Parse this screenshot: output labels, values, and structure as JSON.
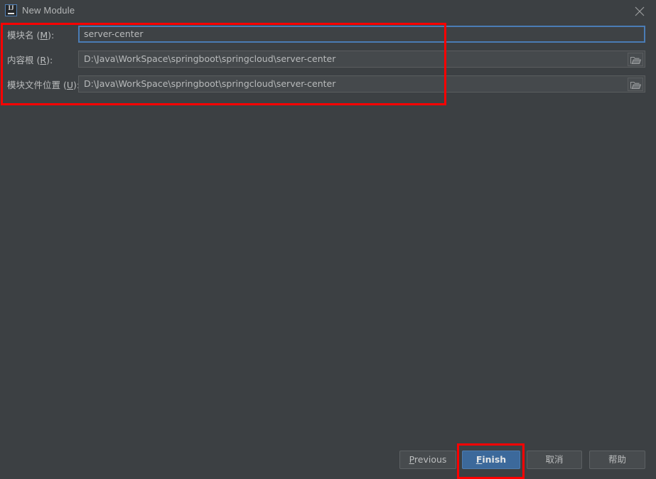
{
  "window": {
    "title": "New Module",
    "icon": "intellij-idea-icon",
    "icon_text": "IJ",
    "close_icon": "close-icon"
  },
  "form": {
    "rows": [
      {
        "label_text": "模块名 ",
        "label_mnemonic_open": "(",
        "label_mnemonic": "M",
        "label_mnemonic_close": "):",
        "value": "server-center",
        "focused": true,
        "has_browse": false,
        "name": "module-name"
      },
      {
        "label_text": "内容根 ",
        "label_mnemonic_open": "(",
        "label_mnemonic": "R",
        "label_mnemonic_close": "):",
        "value": "D:\\Java\\WorkSpace\\springboot\\springcloud\\server-center",
        "focused": false,
        "has_browse": true,
        "name": "content-root"
      },
      {
        "label_text": "模块文件位置 ",
        "label_mnemonic_open": "(",
        "label_mnemonic": "U",
        "label_mnemonic_close": "):",
        "value": "D:\\Java\\WorkSpace\\springboot\\springcloud\\server-center",
        "focused": false,
        "has_browse": true,
        "name": "module-file-location"
      }
    ],
    "browse_icon": "folder-icon"
  },
  "buttons": {
    "previous": {
      "mnemonic": "P",
      "rest": "revious"
    },
    "finish": {
      "mnemonic": "F",
      "rest": "inish"
    },
    "cancel": {
      "label": "取消"
    },
    "help": {
      "label": "帮助"
    }
  },
  "annotations": {
    "color": "#ff0000",
    "fields_box": "highlight-around-module-fields",
    "finish_box": "highlight-around-finish-button"
  },
  "colors": {
    "background": "#3c4043",
    "field_background": "#45494c",
    "focus_border": "#4a7cb5",
    "primary_button": "#3c699b",
    "annotation": "#ff0000",
    "text": "#bbbdbe"
  }
}
